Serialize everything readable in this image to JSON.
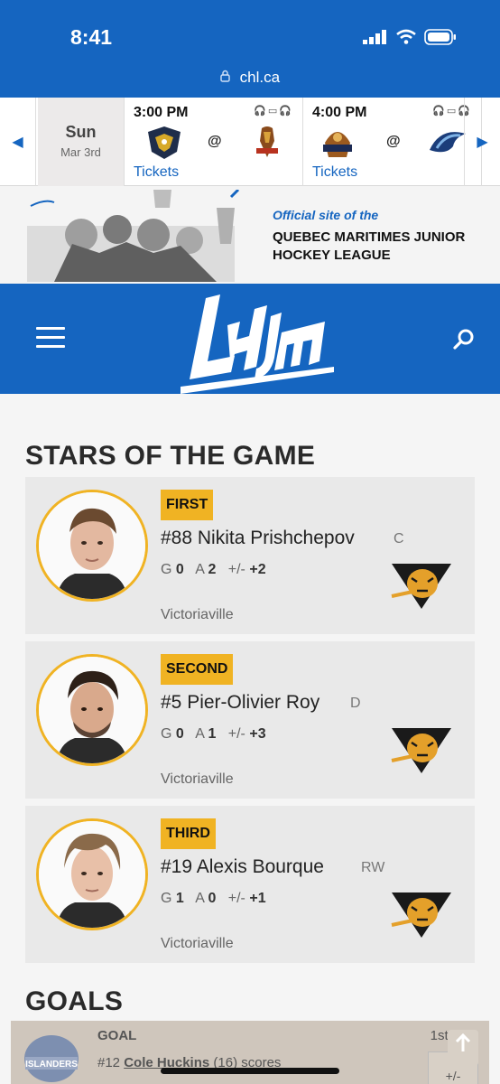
{
  "status_bar": {
    "time": "8:41"
  },
  "browser": {
    "url": "chl.ca"
  },
  "scoreboard": {
    "day": "Sun",
    "date": "Mar 3rd",
    "games": [
      {
        "time": "3:00 PM",
        "at": "@",
        "tickets": "Tickets"
      },
      {
        "time": "4:00 PM",
        "at": "@",
        "tickets": "Tickets"
      }
    ]
  },
  "banner": {
    "official": "Official site of the",
    "line1": "QUEBEC MARITIMES JUNIOR",
    "line2": "HOCKEY LEAGUE"
  },
  "header": {
    "logo_text": "LHJMQ"
  },
  "stars": {
    "title": "STARS OF THE GAME",
    "items": [
      {
        "rank": "FIRST",
        "name": "#88 Nikita Prishchepov",
        "pos": "C",
        "g_label": "G",
        "g": "0",
        "a_label": "A",
        "a": "2",
        "pm_label": "+/-",
        "pm": "+2",
        "team": "Victoriaville"
      },
      {
        "rank": "SECOND",
        "name": "#5 Pier-Olivier Roy",
        "pos": "D",
        "g_label": "G",
        "g": "0",
        "a_label": "A",
        "a": "1",
        "pm_label": "+/-",
        "pm": "+3",
        "team": "Victoriaville"
      },
      {
        "rank": "THIRD",
        "name": "#19 Alexis Bourque",
        "pos": "RW",
        "g_label": "G",
        "g": "1",
        "a_label": "A",
        "a": "0",
        "pm_label": "+/-",
        "pm": "+1",
        "team": "Victoriaville"
      }
    ]
  },
  "goals": {
    "title": "GOALS",
    "first": {
      "label": "GOAL",
      "time": "1st 6:41",
      "text_prefix": "#12 ",
      "scorer": "Cole Huckins",
      "text_suffix": " (16) scores",
      "pm": "+/-"
    }
  },
  "colors": {
    "brand_blue": "#1565c0",
    "gold": "#f0b323"
  }
}
